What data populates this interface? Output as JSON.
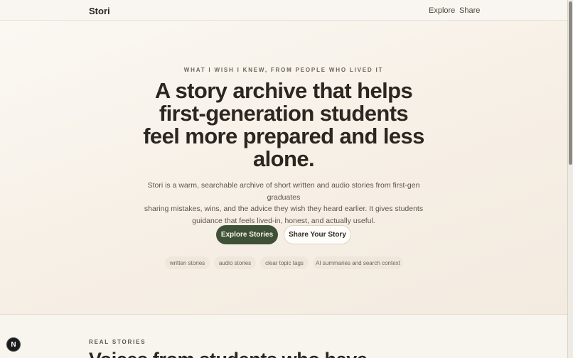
{
  "nav": {
    "brand": "Stori",
    "links": [
      "Explore",
      "Share"
    ]
  },
  "hero": {
    "eyebrow": "WHAT I WISH I KNEW, FROM PEOPLE WHO LIVED IT",
    "headline_lines": [
      "A story archive that helps",
      "first-generation students",
      "feel more prepared and less",
      "alone."
    ],
    "lede_lines": [
      "Stori is a warm, searchable archive of short written and audio stories from first-gen graduates",
      "sharing mistakes, wins, and the advice they wish they heard earlier. It gives students",
      "guidance that feels lived-in, honest, and actually useful."
    ],
    "primary_button": "Explore Stories",
    "secondary_button": "Share Your Story",
    "tags": [
      "written stories",
      "audio stories",
      "clear topic tags",
      "AI summaries and search context"
    ]
  },
  "section": {
    "label": "REAL STORIES",
    "title": "Voices from students who have"
  },
  "badge": {
    "letter": "N"
  },
  "colors": {
    "accent": "#3e5137",
    "background": "#f8f4ee",
    "text": "#2b2620"
  }
}
